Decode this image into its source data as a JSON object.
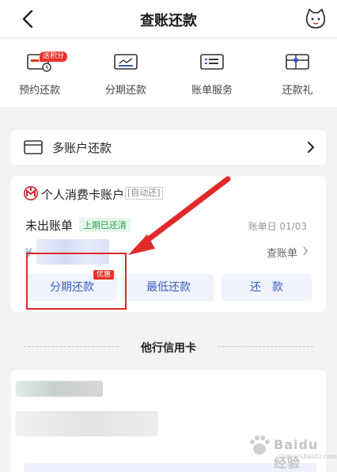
{
  "header": {
    "title": "查账还款"
  },
  "quick_actions": [
    {
      "label": "预约还款",
      "icon": "schedule-repay-icon",
      "badge": "送积分"
    },
    {
      "label": "分期还款",
      "icon": "installment-icon"
    },
    {
      "label": "账单服务",
      "icon": "bill-service-icon"
    },
    {
      "label": "还款礼",
      "icon": "repay-gift-icon"
    }
  ],
  "multi_account": {
    "label": "多账户还款"
  },
  "account": {
    "title": "个人消费卡账户",
    "auto_tag": "[自动还]",
    "bill_label": "未出账单",
    "status_tag": "上期已还清",
    "bill_day": "账单日 01/03",
    "currency": "¥",
    "view_bill": "查账单",
    "buttons": {
      "installment": "分期还款",
      "promo": "优惠",
      "minimum": "最低还款",
      "repay": "还　款"
    }
  },
  "other_section": {
    "title": "他行信用卡"
  },
  "watermark": {
    "text": "Baidu经验",
    "sub": "jingyan.baidu.com"
  },
  "colors": {
    "accent": "#3b5bbd",
    "annotation_red": "#e02a2a",
    "success_green": "#2aa34a"
  }
}
